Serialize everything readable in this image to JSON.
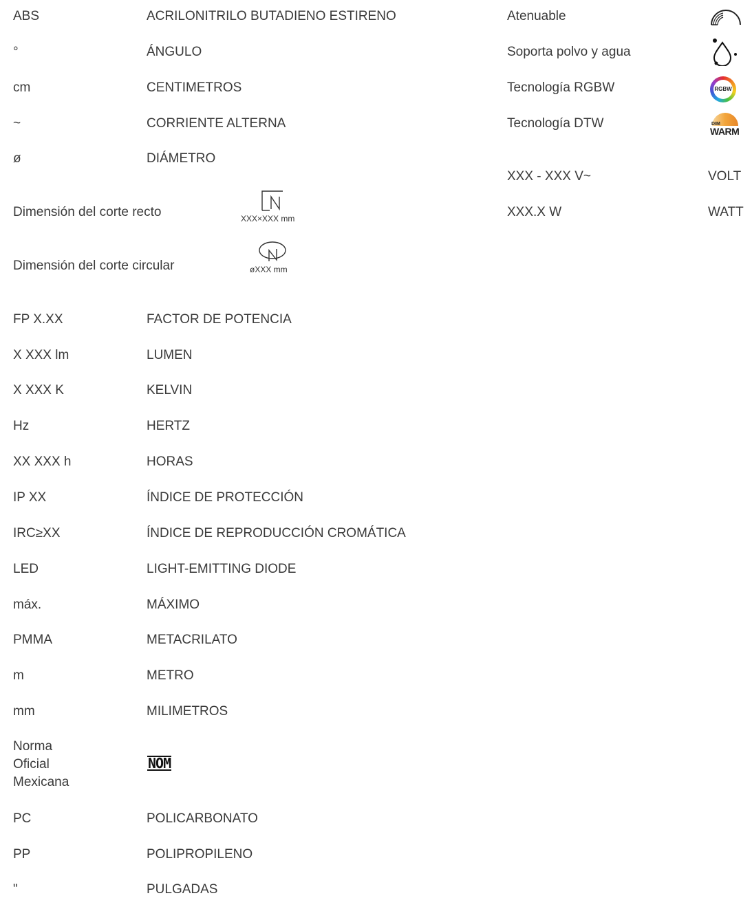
{
  "left_rows": [
    {
      "abbr": "ABS",
      "meaning": "ACRILONITRILO BUTADIENO ESTIRENO"
    },
    {
      "abbr": "°",
      "meaning": "ÁNGULO"
    },
    {
      "abbr": "cm",
      "meaning": "CENTIMETROS"
    },
    {
      "abbr": "~",
      "meaning": "CORRIENTE ALTERNA"
    },
    {
      "abbr": "ø",
      "meaning": "DIÁMETRO"
    }
  ],
  "cuts": {
    "straight_label": "Dimensión del corte recto",
    "straight_value": "XXX×XXX mm",
    "circular_label": "Dimensión del corte circular",
    "circular_value": "øXXX mm"
  },
  "rows2": [
    {
      "abbr": "FP X.XX",
      "meaning": "FACTOR DE POTENCIA"
    },
    {
      "abbr": "X XXX lm",
      "meaning": "LUMEN"
    },
    {
      "abbr": "X XXX K",
      "meaning": "KELVIN"
    },
    {
      "abbr": "Hz",
      "meaning": "HERTZ"
    },
    {
      "abbr": "XX XXX h",
      "meaning": "HORAS"
    },
    {
      "abbr": "IP XX",
      "meaning": "ÍNDICE DE PROTECCIÓN"
    },
    {
      "abbr": "IRC≥XX",
      "meaning": "ÍNDICE DE REPRODUCCIÓN CROMÁTICA"
    },
    {
      "abbr": "LED",
      "meaning": "LIGHT-EMITTING DIODE"
    },
    {
      "abbr": "máx.",
      "meaning": "MÁXIMO"
    },
    {
      "abbr": "PMMA",
      "meaning": "METACRILATO"
    },
    {
      "abbr": "m",
      "meaning": "METRO"
    },
    {
      "abbr": "mm",
      "meaning": "MILIMETROS"
    }
  ],
  "nom": {
    "label": "Norma Oficial Mexicana",
    "mark": "NOM"
  },
  "rows3": [
    {
      "abbr": "PC",
      "meaning": "POLICARBONATO"
    },
    {
      "abbr": "PP",
      "meaning": "POLIPROPILENO"
    },
    {
      "abbr": "\"",
      "meaning": "PULGADAS"
    }
  ],
  "right_features": [
    {
      "label": "Atenuable",
      "icon": "dimmable-icon"
    },
    {
      "label": "Soporta polvo y agua",
      "icon": "dust-water-icon"
    },
    {
      "label": "Tecnología RGBW",
      "icon": "rgbw-icon",
      "icon_text": "RGBW"
    },
    {
      "label": "Tecnología DTW",
      "icon": "dim-warm-icon",
      "icon_text_small": "DIM",
      "icon_text": "WARM"
    }
  ],
  "right_units": [
    {
      "value": "XXX - XXX V~",
      "unit": "VOLT"
    },
    {
      "value": "XXX.X W",
      "unit": "WATT"
    }
  ]
}
